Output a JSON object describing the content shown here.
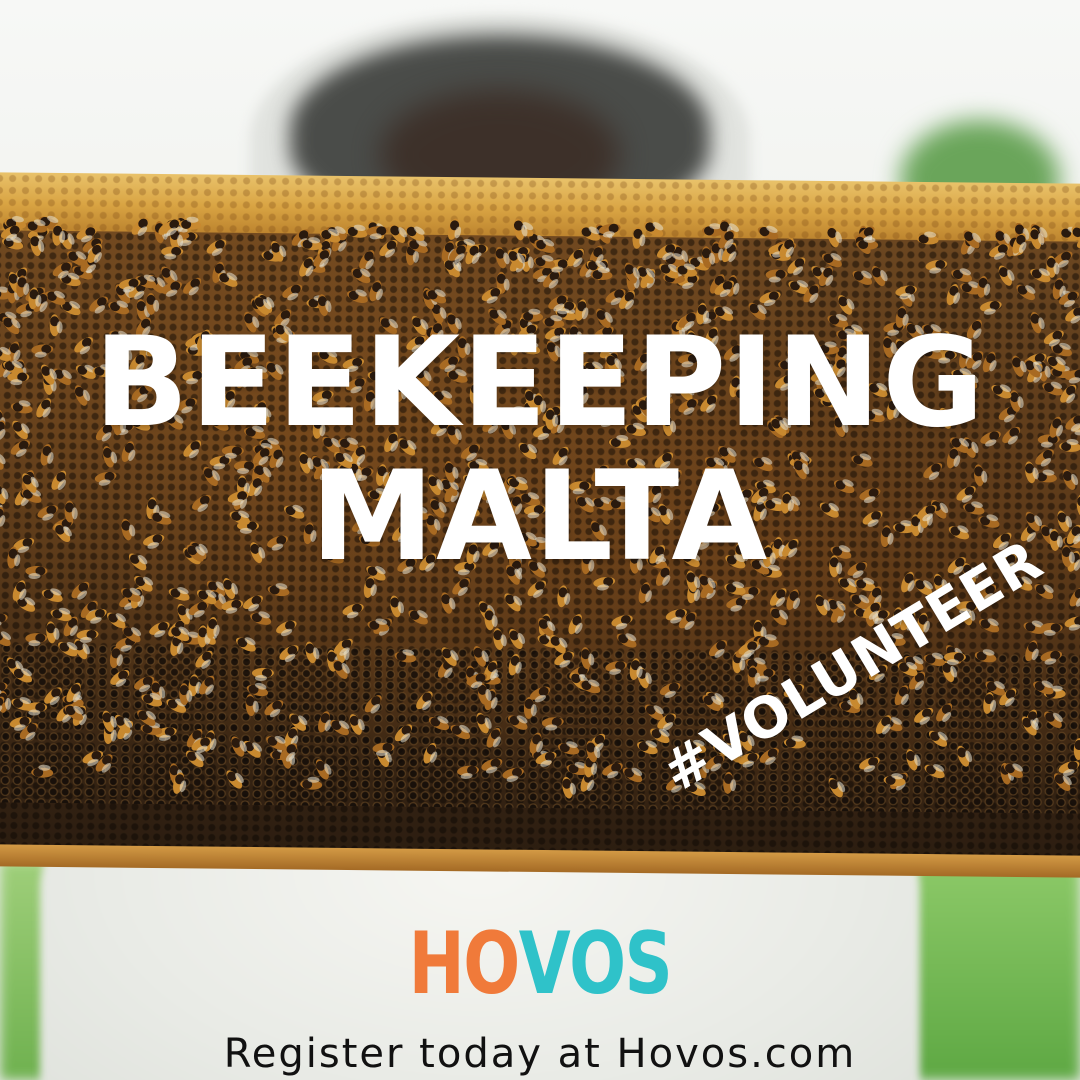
{
  "title": {
    "line1": "BEEKEEPING",
    "line2": "MALTA"
  },
  "hashtag": "#VOLUNTEER",
  "logo": {
    "parts": [
      {
        "text": "H",
        "color": "#f07a3a"
      },
      {
        "text": "O",
        "color": "#f07a3a"
      },
      {
        "text": "V",
        "color": "#2fc2c9"
      },
      {
        "text": "O",
        "color": "#2fc2c9"
      },
      {
        "text": "S",
        "color": "#2fc2c9"
      }
    ]
  },
  "cta": "Register today at Hovos.com",
  "colors": {
    "logo_orange": "#f07a3a",
    "logo_teal": "#2fc2c9",
    "headline": "#ffffff",
    "cta_text": "#111111"
  }
}
